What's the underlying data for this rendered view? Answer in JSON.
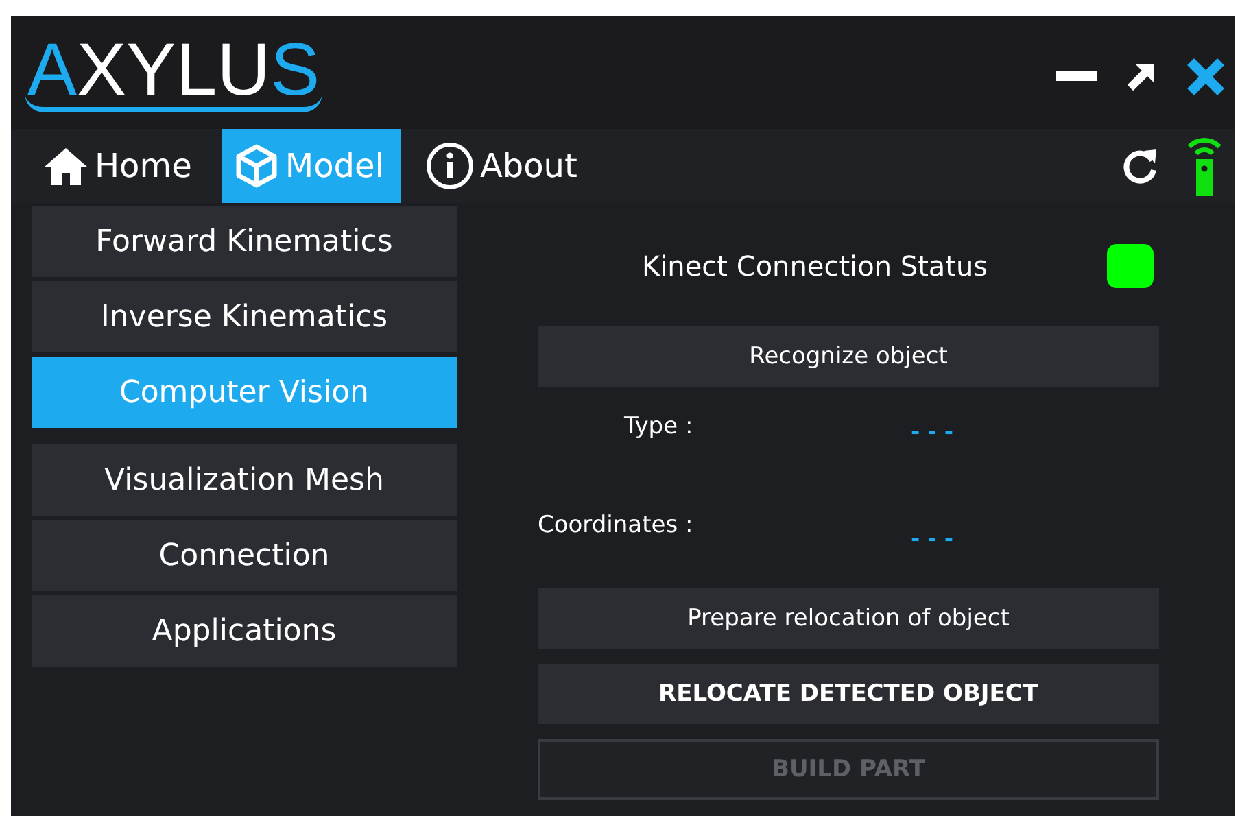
{
  "window": {
    "logo": "AXYLUS",
    "controls": [
      {
        "kind": "minimize"
      },
      {
        "kind": "maximize"
      },
      {
        "kind": "close"
      }
    ]
  },
  "tabs": [
    {
      "label": "Home",
      "kind": "home",
      "selected": false
    },
    {
      "label": "Model",
      "kind": "model",
      "selected": true
    },
    {
      "label": "About",
      "kind": "about",
      "selected": false
    }
  ],
  "toolbar": {
    "device_connected": true
  },
  "sidebar": {
    "items": [
      {
        "label": "Forward Kinematics",
        "selected": false
      },
      {
        "label": "Inverse Kinematics",
        "selected": false
      },
      {
        "label": "Computer Vision",
        "selected": true
      },
      {
        "label": "Visualization Mesh",
        "selected": false
      },
      {
        "label": "Connection",
        "selected": false
      },
      {
        "label": "Applications",
        "selected": false
      }
    ]
  },
  "panel": {
    "status_label": "Kinect Connection Status",
    "kinect_connected": true,
    "recognize_button": {
      "label": "Recognize object",
      "disabled": false
    },
    "fields": [
      {
        "label": "Type :",
        "value": "- - -"
      },
      {
        "label": "Coordinates :",
        "value": "- - -"
      }
    ],
    "buttons": [
      {
        "label": "Prepare relocation of object",
        "disabled": false,
        "bold": false
      },
      {
        "label": "RELOCATE DETECTED OBJECT",
        "disabled": false,
        "bold": true
      },
      {
        "label": "BUILD PART",
        "disabled": true,
        "bold": true
      }
    ]
  }
}
